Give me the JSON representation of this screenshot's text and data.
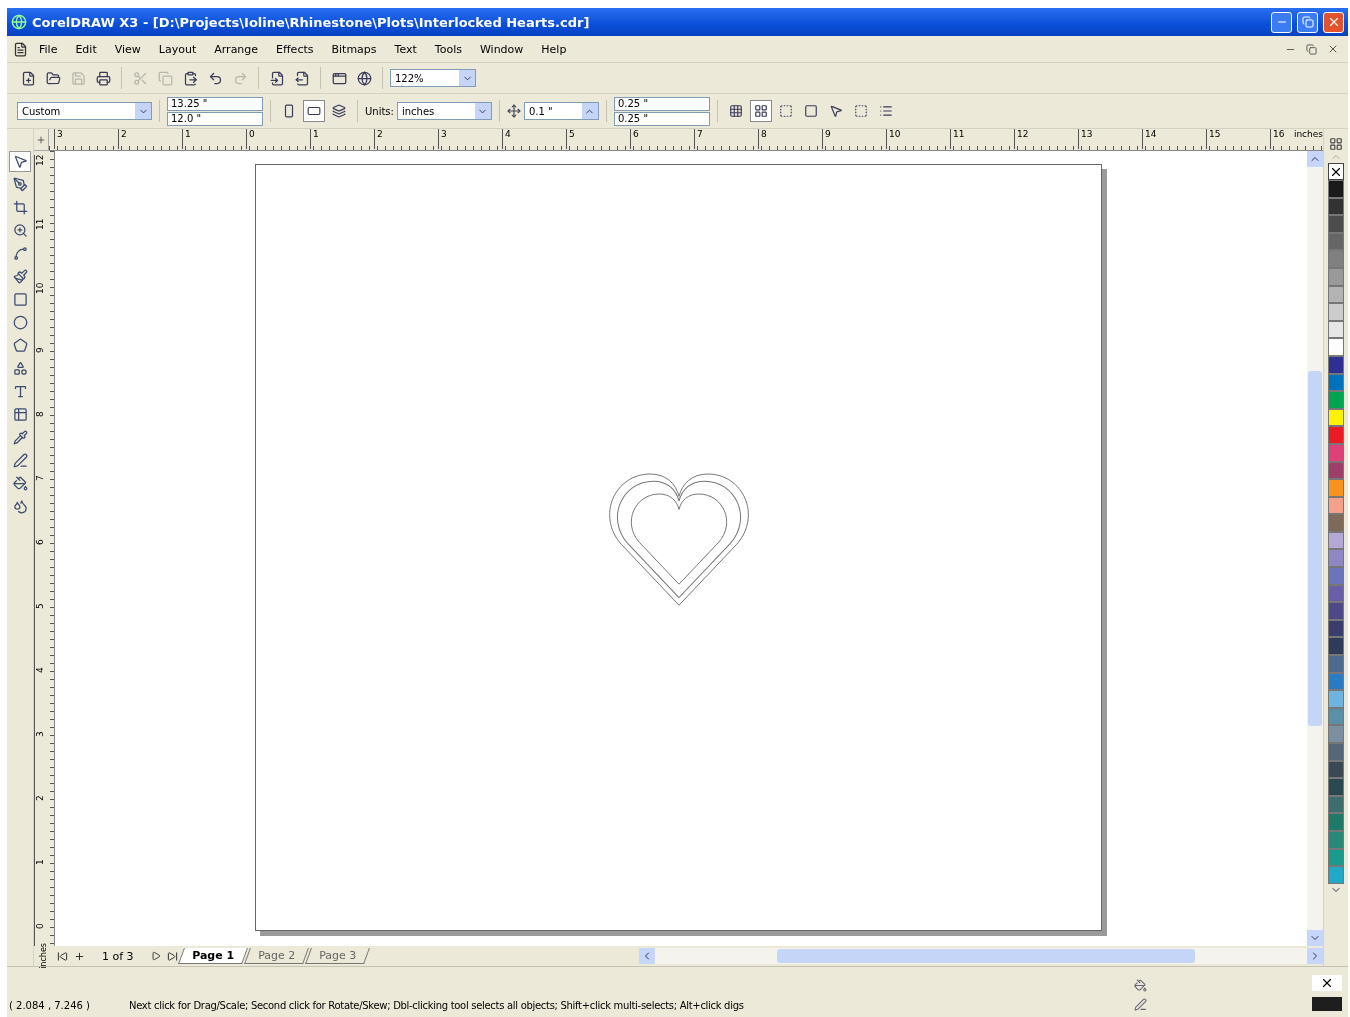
{
  "window": {
    "title": "CorelDRAW X3 - [D:\\Projects\\Ioline\\Rhinestone\\Plots\\Interlocked Hearts.cdr]"
  },
  "menu": [
    "File",
    "Edit",
    "View",
    "Layout",
    "Arrange",
    "Effects",
    "Bitmaps",
    "Text",
    "Tools",
    "Window",
    "Help"
  ],
  "standard_toolbar": {
    "buttons": [
      {
        "disabled": false
      },
      {
        "disabled": false
      },
      {
        "disabled": true
      },
      {
        "disabled": false
      },
      {
        "disabled": true
      },
      {
        "disabled": true
      },
      {
        "disabled": false
      },
      {
        "disabled": false
      },
      {
        "disabled": true
      },
      {
        "disabled": false
      },
      {
        "disabled": false
      },
      {
        "disabled": false
      },
      {
        "disabled": false
      }
    ],
    "zoom": "122%"
  },
  "property_bar": {
    "paper": "Custom",
    "width": "13.25 \"",
    "height": "12.0 \"",
    "orientation": [
      {
        "selected": false
      },
      {
        "selected": true
      }
    ],
    "units_label": "Units:",
    "units": "inches",
    "nudge": "0.1 \"",
    "duplicate_x": "0.25 \"",
    "duplicate_y": "0.25 \""
  },
  "rulers": {
    "horizontal": [
      "3",
      "2",
      "1",
      "0",
      "1",
      "2",
      "3",
      "4",
      "5",
      "6",
      "7",
      "8",
      "9",
      "10",
      "11",
      "12",
      "13",
      "14",
      "15",
      "16"
    ],
    "horizontal_unit": "inches",
    "vertical": [
      "12",
      "11",
      "10",
      "9",
      "8",
      "7",
      "6",
      "5",
      "4",
      "3",
      "2",
      "1",
      "0"
    ],
    "vertical_unit": "inches"
  },
  "page_nav": {
    "counter": "1 of 3",
    "tabs": [
      {
        "label": "Page 1",
        "selected": true
      },
      {
        "label": "Page 2",
        "selected": false
      },
      {
        "label": "Page 3",
        "selected": false
      }
    ]
  },
  "palette": [
    {
      "color": "#1a1a1a"
    },
    {
      "color": "#333333"
    },
    {
      "color": "#4d4d4d"
    },
    {
      "color": "#666666"
    },
    {
      "color": "#808080"
    },
    {
      "color": "#999999"
    },
    {
      "color": "#b3b3b3"
    },
    {
      "color": "#cccccc"
    },
    {
      "color": "#e6e6e6"
    },
    {
      "color": "#ffffff"
    },
    {
      "color": "#2e3192"
    },
    {
      "color": "#0072bc"
    },
    {
      "color": "#00a651"
    },
    {
      "color": "#fff200"
    },
    {
      "color": "#ed1c24"
    },
    {
      "color": "#e0407a"
    },
    {
      "color": "#9e3f6a"
    },
    {
      "color": "#f7941d"
    },
    {
      "color": "#f4a08a"
    },
    {
      "color": "#7d6a5a"
    },
    {
      "color": "#b4a8d6"
    },
    {
      "color": "#8f86c4"
    },
    {
      "color": "#6a74b8"
    },
    {
      "color": "#6b5ea8"
    },
    {
      "color": "#4e4a8a"
    },
    {
      "color": "#3b3d6e"
    },
    {
      "color": "#2f3c5c"
    },
    {
      "color": "#4d6b8f"
    },
    {
      "color": "#2a7cc4"
    },
    {
      "color": "#6fb3e0"
    },
    {
      "color": "#5a8fa8"
    },
    {
      "color": "#7a8fa0"
    },
    {
      "color": "#556877"
    },
    {
      "color": "#3a4a55"
    },
    {
      "color": "#284a50"
    },
    {
      "color": "#3d6e6e"
    },
    {
      "color": "#1f7a6a"
    },
    {
      "color": "#2a8a7a"
    },
    {
      "color": "#1a9a8a"
    },
    {
      "color": "#20a8c8"
    }
  ],
  "status_bar": {
    "coordinates": "( 2.084 , 7.246 )",
    "message": "Next click for Drag/Scale; Second click for Rotate/Skew; Dbl-clicking tool selects all objects; Shift+click multi-selects; Alt+click digs"
  }
}
